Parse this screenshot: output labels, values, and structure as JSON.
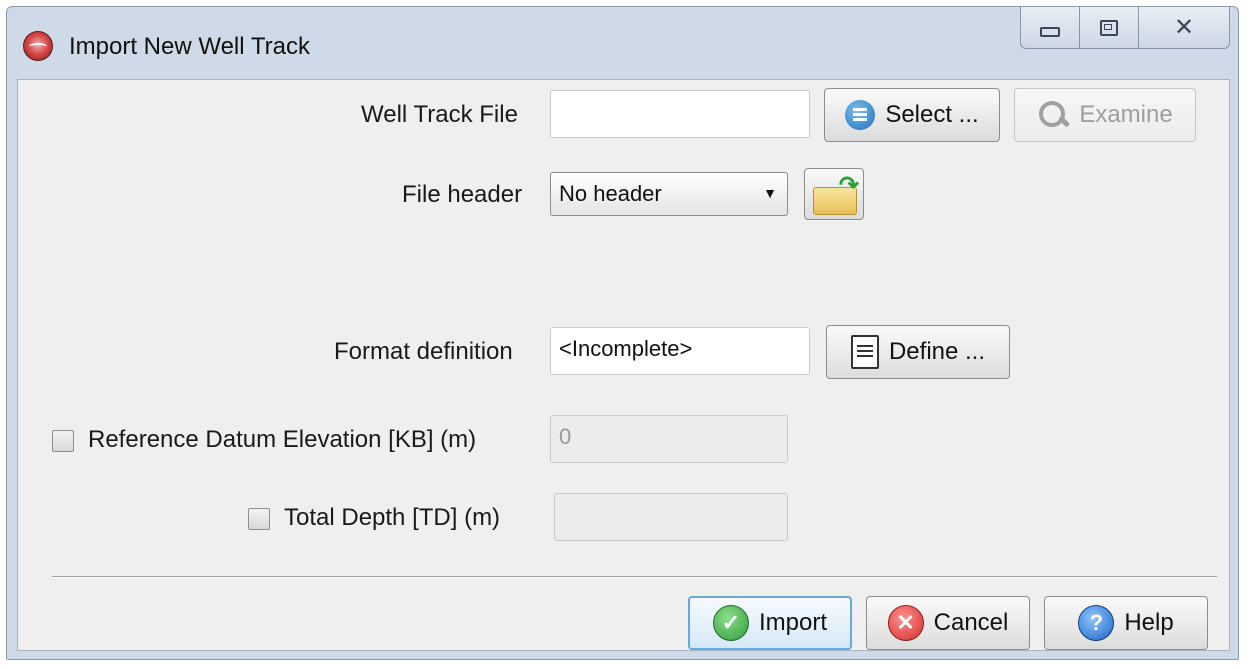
{
  "window": {
    "title": "Import New Well Track",
    "icon": "app-logo-icon",
    "controls": {
      "minimize": "minimize-icon",
      "maximize": "maximize-icon",
      "close": "close-icon"
    }
  },
  "well_track": {
    "label": "Well Track File",
    "value": "",
    "select_label": "Select ...",
    "examine_label": "Examine"
  },
  "file_header": {
    "label": "File header",
    "selected": "No header"
  },
  "format": {
    "label": "Format definition",
    "value": "<Incomplete>",
    "define_label": "Define ..."
  },
  "reference_datum": {
    "label": "Reference Datum Elevation [KB] (m)",
    "checked": false,
    "value": "0"
  },
  "total_depth": {
    "label": "Total Depth [TD] (m)",
    "checked": false,
    "value": ""
  },
  "footer": {
    "import_label": "Import",
    "cancel_label": "Cancel",
    "help_label": "Help",
    "help_glyph": "?"
  }
}
